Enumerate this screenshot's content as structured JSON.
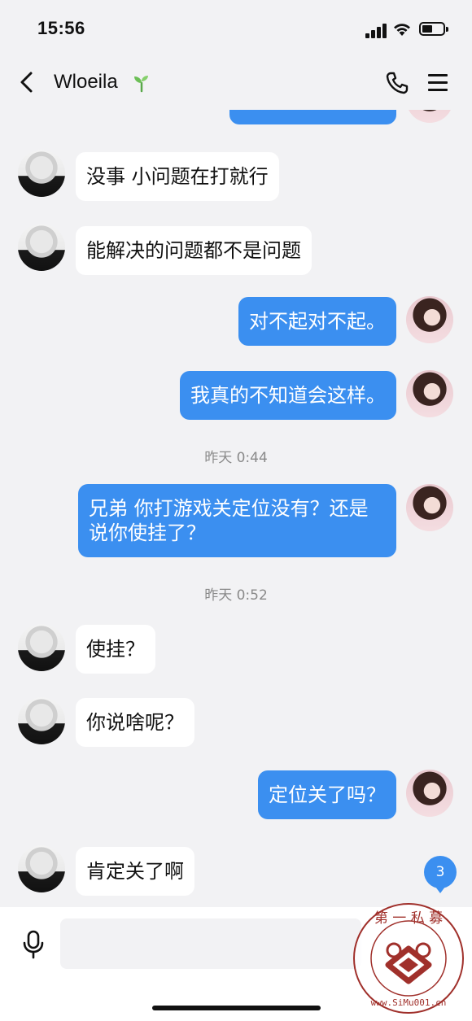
{
  "status_bar": {
    "time": "15:56"
  },
  "header": {
    "title": "Wloeila",
    "back_icon": "chevron-left-icon",
    "call_icon": "phone-icon",
    "menu_icon": "hamburger-menu-icon"
  },
  "messages": [
    {
      "side": "in",
      "text": "没事 小问题在打就行"
    },
    {
      "side": "in",
      "text": "能解决的问题都不是问题"
    },
    {
      "side": "out",
      "text": "对不起对不起。"
    },
    {
      "side": "out",
      "text": "我真的不知道会这样。"
    },
    {
      "timestamp": "昨天 0:44"
    },
    {
      "side": "out",
      "text_line1": "兄弟 你打游戏关定位没有？还是",
      "text_line2": "说你使挂了？"
    },
    {
      "timestamp": "昨天 0:52"
    },
    {
      "side": "in",
      "text": "使挂？"
    },
    {
      "side": "in",
      "text": "你说啥呢？"
    },
    {
      "side": "out",
      "text": "定位关了吗？"
    },
    {
      "side": "in",
      "text": "肯定关了啊"
    }
  ],
  "unread_count": "3",
  "input": {
    "placeholder": "",
    "mic_icon": "microphone-icon"
  },
  "watermark": {
    "top_text": "第 一 私 募",
    "bottom_text": "www.SiMu001.cn"
  },
  "colors": {
    "outgoing_bubble": "#3b8ff0",
    "incoming_bubble": "#ffffff",
    "background": "#f2f2f4"
  }
}
